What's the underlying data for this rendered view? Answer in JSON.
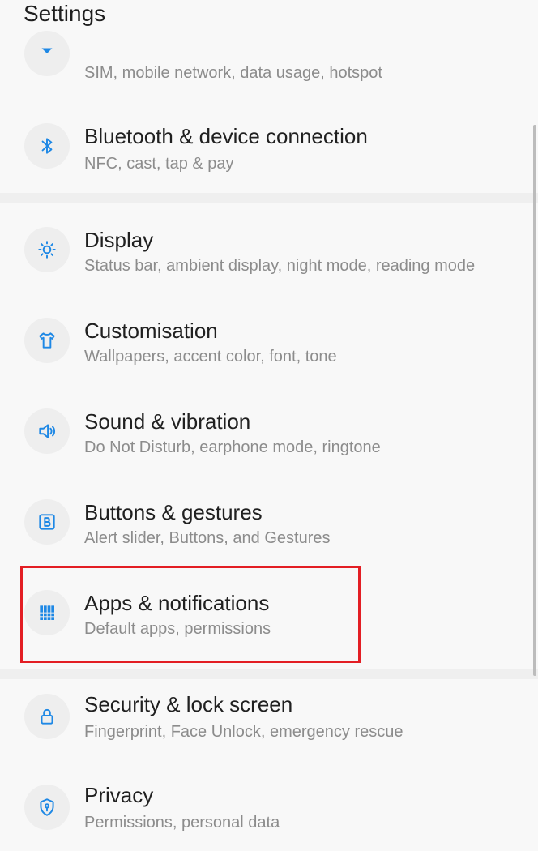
{
  "header": {
    "title": "Settings"
  },
  "items": [
    {
      "id": "wifi-network",
      "title": "",
      "subtitle": "SIM, mobile network, data usage, hotspot",
      "icon": "network-icon"
    },
    {
      "id": "bluetooth",
      "title": "Bluetooth & device connection",
      "subtitle": "NFC, cast, tap & pay",
      "icon": "bluetooth-icon"
    },
    {
      "id": "display",
      "title": "Display",
      "subtitle": "Status bar, ambient display, night mode, reading mode",
      "icon": "brightness-icon"
    },
    {
      "id": "customisation",
      "title": "Customisation",
      "subtitle": "Wallpapers, accent color, font, tone",
      "icon": "shirt-icon"
    },
    {
      "id": "sound",
      "title": "Sound & vibration",
      "subtitle": "Do Not Disturb, earphone mode, ringtone",
      "icon": "speaker-icon"
    },
    {
      "id": "buttons",
      "title": "Buttons & gestures",
      "subtitle": "Alert slider, Buttons, and Gestures",
      "icon": "button-b-icon"
    },
    {
      "id": "apps",
      "title": "Apps & notifications",
      "subtitle": "Default apps, permissions",
      "icon": "apps-grid-icon"
    },
    {
      "id": "security",
      "title": "Security & lock screen",
      "subtitle": "Fingerprint, Face Unlock, emergency rescue",
      "icon": "lock-icon"
    },
    {
      "id": "privacy",
      "title": "Privacy",
      "subtitle": "Permissions, personal data",
      "icon": "shield-icon"
    }
  ],
  "colors": {
    "accent": "#1e88e5",
    "highlight": "#e31e24"
  }
}
